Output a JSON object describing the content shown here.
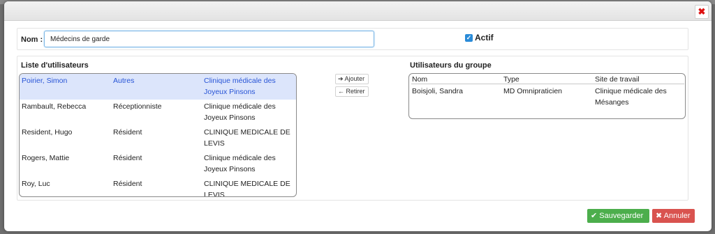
{
  "dialog": {
    "close_glyph": "✖"
  },
  "form": {
    "name_label": "Nom :",
    "name_value": "Médecins de garde",
    "active_label": "Actif",
    "active_checked": true
  },
  "user_list": {
    "title": "Liste d'utilisateurs",
    "rows": [
      {
        "name": "Poirier, Simon",
        "type": "Autres",
        "site": "Clinique médicale des Joyeux Pinsons",
        "selected": true
      },
      {
        "name": "Rambault, Rebecca",
        "type": "Réceptionniste",
        "site": "Clinique médicale des Joyeux Pinsons",
        "selected": false
      },
      {
        "name": "Resident, Hugo",
        "type": "Résident",
        "site": "CLINIQUE MEDICALE DE LEVIS",
        "selected": false
      },
      {
        "name": "Rogers, Mattie",
        "type": "Résident",
        "site": "Clinique médicale des Joyeux Pinsons",
        "selected": false
      },
      {
        "name": "Roy, Luc",
        "type": "Résident",
        "site": "CLINIQUE MEDICALE DE LEVIS",
        "selected": false
      }
    ]
  },
  "actions": {
    "add_label": "➔ Ajouter",
    "remove_label": "← Retirer"
  },
  "group_users": {
    "title": "Utilisateurs du groupe",
    "headers": [
      "Nom",
      "Type",
      "Site de travail"
    ],
    "rows": [
      {
        "name": "Boisjoli, Sandra",
        "type": "MD Omnipraticien",
        "site": "Clinique médicale des Mésanges"
      }
    ]
  },
  "footer": {
    "save_label": "✔ Sauvegarder",
    "cancel_label": "✖ Annuler"
  },
  "colors": {
    "accent": "#2a8bd8",
    "selected_row": "#dce5fb",
    "selected_text": "#2754d6",
    "save": "#4cae4c",
    "cancel": "#d9534f",
    "close": "#dd1111"
  },
  "icons": {
    "close": "close-icon",
    "check": "check-icon",
    "add": "arrow-right-icon",
    "remove": "arrow-left-icon"
  }
}
